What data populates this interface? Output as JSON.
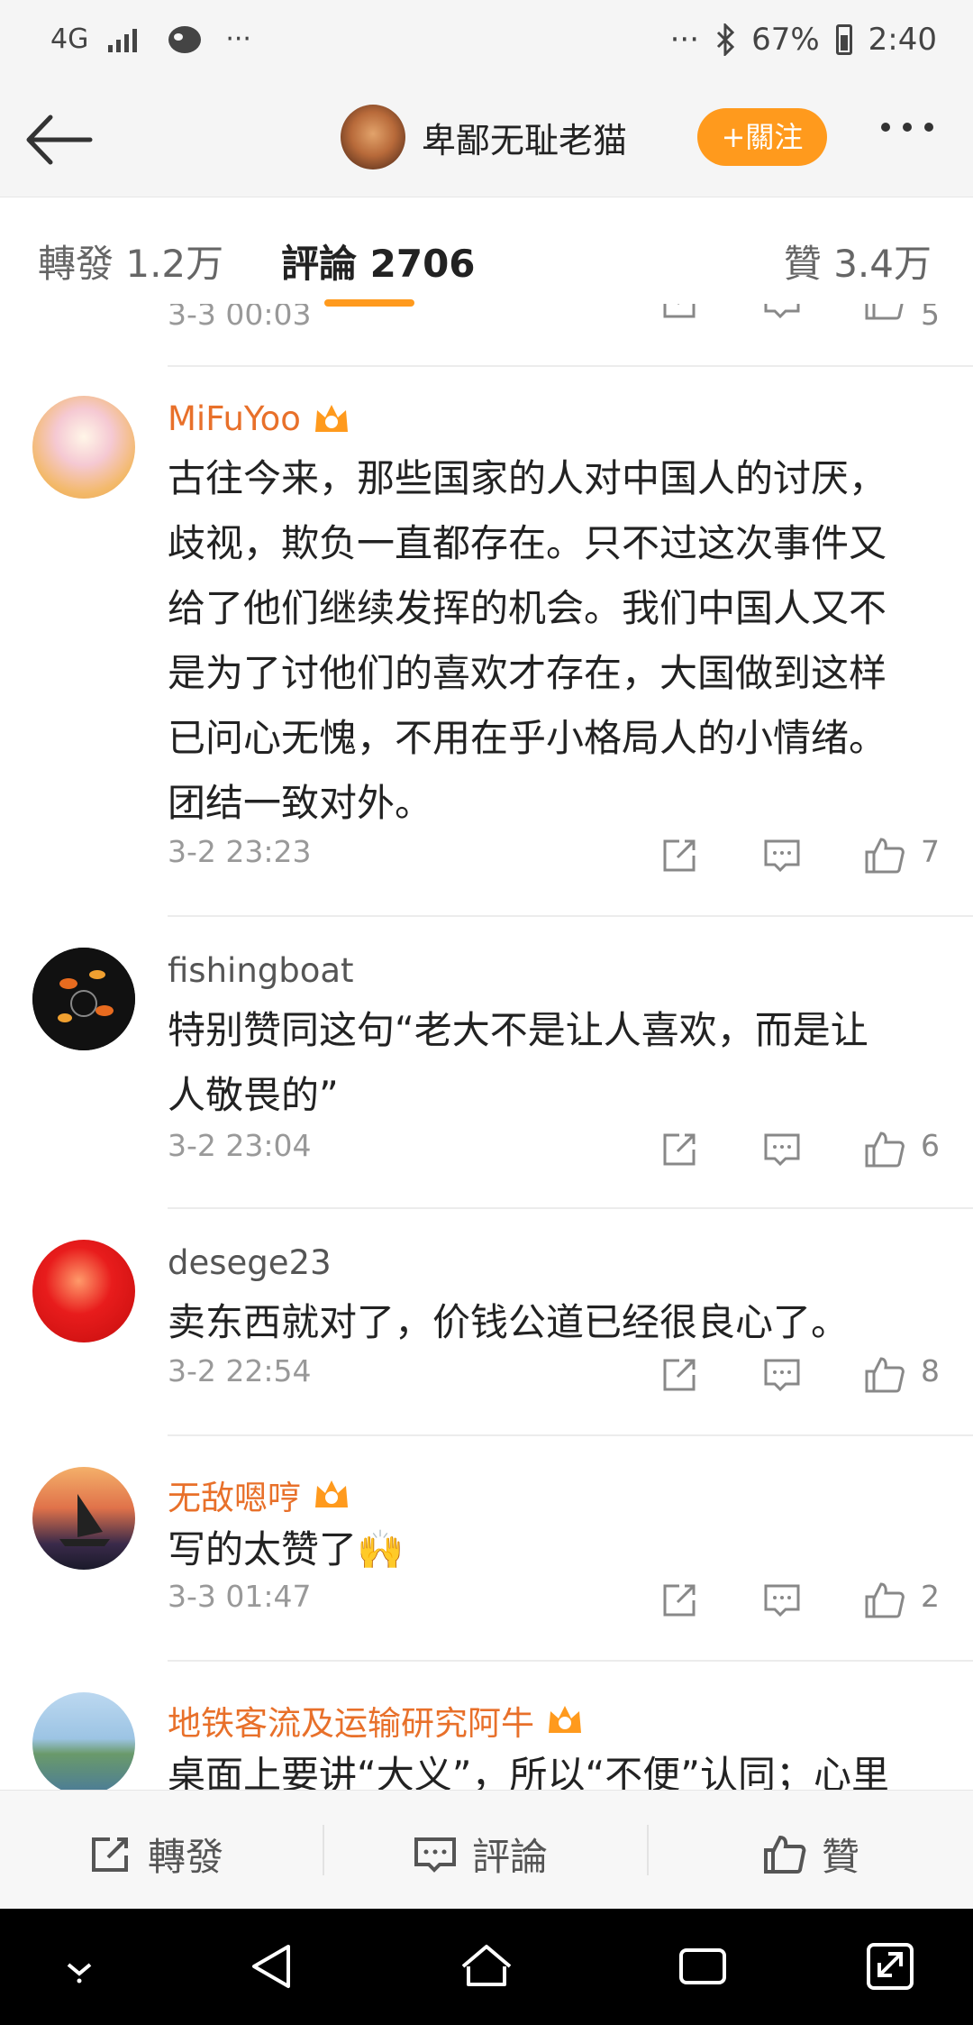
{
  "status_bar": {
    "network": "4G",
    "dots": "···",
    "battery": "67%",
    "time": "2:40"
  },
  "header": {
    "user_name": "卑鄙无耻老猫",
    "follow_label": "+關注"
  },
  "tabs": {
    "repost": "轉發 1.2万",
    "comments": "評論 2706",
    "likes": "贊 3.4万"
  },
  "partial_comment": {
    "time": "3-3 00:03",
    "likes": "5"
  },
  "comments": [
    {
      "user": "MiFuYoo",
      "vip": true,
      "lines": [
        "古往今来，那些国家的人对中国人的讨厌，",
        "歧视，欺负一直都存在。只不过这次事件又",
        "给了他们继续发挥的机会。我们中国人又不",
        "是为了讨他们的喜欢才存在，大国做到这样",
        "已问心无愧，不用在乎小格局人的小情绪。",
        "团结一致对外。"
      ],
      "time": "3-2 23:23",
      "likes": "7"
    },
    {
      "user": "fishingboat",
      "vip": false,
      "lines": [
        "特别赞同这句“老大不是让人喜欢，而是让",
        "人敬畏的”"
      ],
      "time": "3-2 23:04",
      "likes": "6"
    },
    {
      "user": "desege23",
      "vip": false,
      "lines": [
        "卖东西就对了，价钱公道已经很良心了。"
      ],
      "time": "3-2 22:54",
      "likes": "8"
    },
    {
      "user": "无敌嗯哼",
      "vip": true,
      "lines": [
        "写的太赞了🙌"
      ],
      "time": "3-3 01:47",
      "likes": "2"
    },
    {
      "user": "地铁客流及运输研究阿牛",
      "vip": true,
      "lines": [
        "桌面上要讲“大义”，所以“不便”认同；心里"
      ],
      "time": "",
      "likes": ""
    }
  ],
  "bottom_bar": {
    "repost": "轉發",
    "comment": "評論",
    "like": "贊"
  },
  "colors": {
    "accent": "#ff9a1d",
    "vip_name": "#e8702a"
  }
}
